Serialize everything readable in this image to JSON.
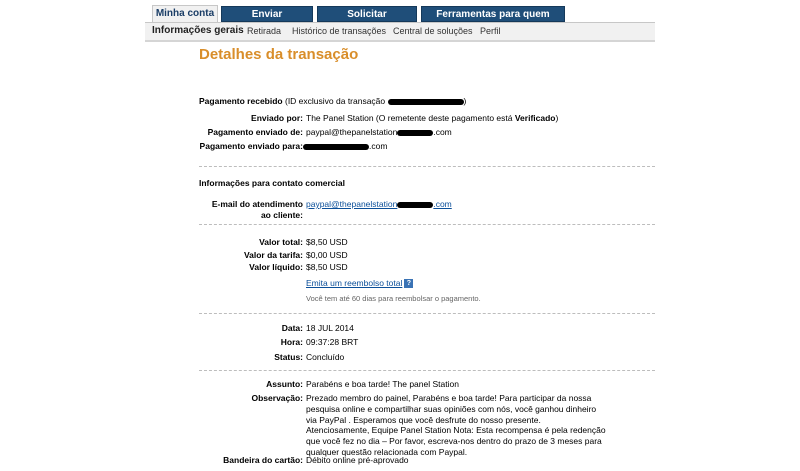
{
  "tabs": [
    {
      "label": "Minha conta",
      "active": true
    },
    {
      "label": "Enviar pagamentos",
      "active": false
    },
    {
      "label": "Solicitar pagamentos",
      "active": false
    },
    {
      "label": "Ferramentas para quem vende",
      "active": false
    }
  ],
  "subnav": [
    "Informações gerais",
    "Retirada",
    "Histórico de transações",
    "Central de soluções",
    "Perfil"
  ],
  "page_title": "Detalhes da transação",
  "payment": {
    "received_label": "Pagamento recebido",
    "received_id_text": "(ID exclusivo da transação",
    "received_id_close": ")",
    "sent_by_label": "Enviado por:",
    "sent_by_value": "The Panel Station (O remetente deste pagamento está ",
    "sent_by_verified": "Verificado",
    "sent_by_close": ")",
    "sent_from_label": "Pagamento enviado de:",
    "sent_from_prefix": "paypal@thepanelstation",
    "sent_from_suffix": ".com",
    "sent_to_label": "Pagamento enviado para:",
    "sent_to_suffix": ".com"
  },
  "contact": {
    "heading": "Informações para contato comercial",
    "email_label_line1": "E-mail do atendimento",
    "email_label_line2": "ao cliente:",
    "email_prefix": "paypal@thepanelstation",
    "email_suffix": ".com"
  },
  "amounts": {
    "total_label": "Valor total:",
    "total_value": "$8,50 USD",
    "fee_label": "Valor da tarifa:",
    "fee_value": "$0,00 USD",
    "net_label": "Valor líquido:",
    "net_value": "$8,50 USD",
    "refund_link": "Emita um reembolso total",
    "refund_note": "Você tem até 60 dias para reembolsar o pagamento."
  },
  "details": {
    "date_label": "Data:",
    "date_value": "18 JUL 2014",
    "time_label": "Hora:",
    "time_value": "09:37:28 BRT",
    "status_label": "Status:",
    "status_value": "Concluído"
  },
  "message": {
    "subject_label": "Assunto:",
    "subject_value": "Parabéns e boa tarde! The panel Station",
    "obs_label": "Observação:",
    "obs_value": "Prezado membro do painel, Parabéns e boa tarde! Para participar da nossa pesquisa online e compartilhar suas opiniões com nós, você ganhou dinheiro via PayPal . Esperamos que você desfrute do nosso presente. Atenciosamente, Equipe Panel Station Nota: Esta recompensa é pela redenção que você fez no dia – Por favor, escreva-nos dentro do prazo de 3 meses para qualquer questão relacionada com Paypal.",
    "card_label": "Bandeira do cartão:",
    "card_value": "Débito online pré-aprovado"
  }
}
